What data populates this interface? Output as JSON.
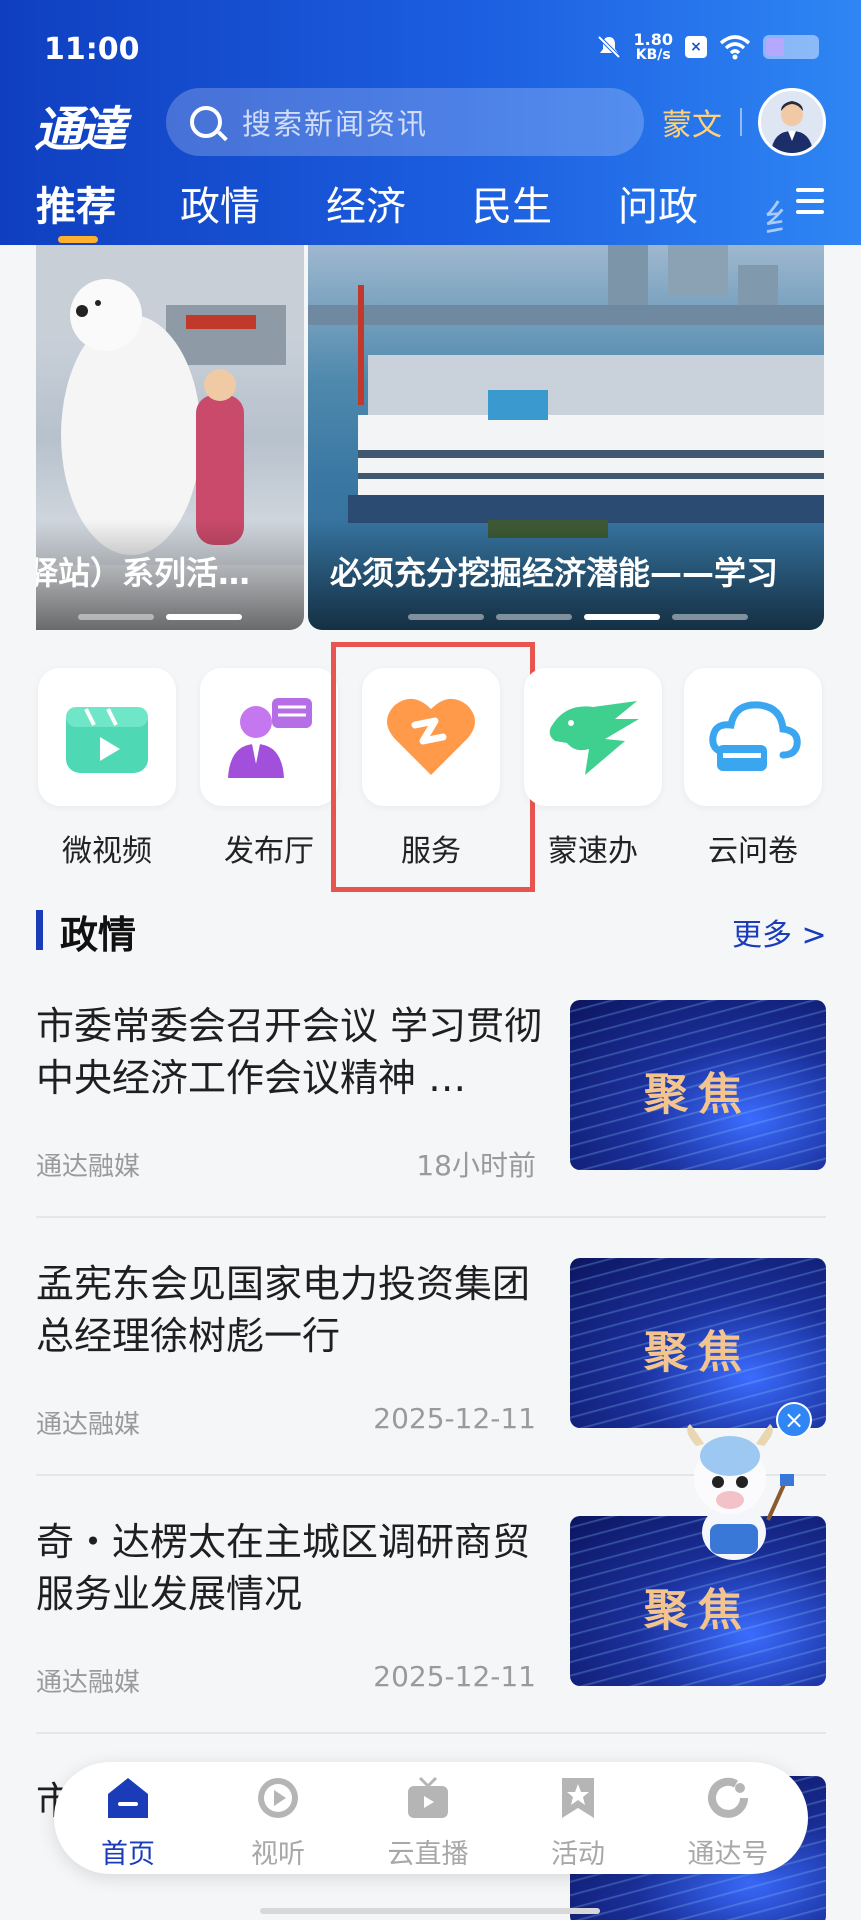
{
  "status_bar": {
    "time": "11:00",
    "net_speed_value": "1.80",
    "net_speed_unit": "KB/s",
    "icons": [
      "mute-icon",
      "sim-icon",
      "wifi-icon",
      "battery-icon"
    ]
  },
  "header": {
    "logo_text": "通達",
    "search_placeholder": "搜索新闻资讯",
    "language_button": "蒙文",
    "tabs": [
      {
        "label": "推荐",
        "active": true
      },
      {
        "label": "政情"
      },
      {
        "label": "经济"
      },
      {
        "label": "民生"
      },
      {
        "label": "问政"
      }
    ],
    "tab_partial": "纟"
  },
  "carousel": {
    "slides": [
      {
        "caption": "驿站）系列活…"
      },
      {
        "caption": "必须充分挖掘经济潜能——学习"
      }
    ]
  },
  "services": [
    {
      "label": "微视频",
      "icon": "video-clapper-icon"
    },
    {
      "label": "发布厅",
      "icon": "spokesperson-icon"
    },
    {
      "label": "服务",
      "icon": "heart-service-icon",
      "highlighted": true
    },
    {
      "label": "蒙速办",
      "icon": "horse-icon"
    },
    {
      "label": "云问卷",
      "icon": "cloud-book-icon"
    }
  ],
  "section": {
    "title": "政情",
    "more": "更多 >"
  },
  "news": [
    {
      "title": "市委常委会召开会议  学习贯彻中央经济工作会议精神  …",
      "source": "通达融媒",
      "time": "18小时前",
      "thumb_text": "聚焦"
    },
    {
      "title": "孟宪东会见国家电力投资集团总经理徐树彪一行",
      "source": "通达融媒",
      "time": "2025-12-11",
      "thumb_text": "聚焦"
    },
    {
      "title": "奇・达楞太在主城区调研商贸服务业发展情况",
      "source": "通达融媒",
      "time": "2025-12-11",
      "thumb_text": "聚焦"
    }
  ],
  "news_peek": "市",
  "mascot": {
    "close": "×"
  },
  "bottom_nav": [
    {
      "label": "首页",
      "icon": "home-icon",
      "active": true
    },
    {
      "label": "视听",
      "icon": "play-icon"
    },
    {
      "label": "云直播",
      "icon": "tv-icon"
    },
    {
      "label": "活动",
      "icon": "star-bookmark-icon"
    },
    {
      "label": "通达号",
      "icon": "refresh-icon"
    }
  ],
  "colors": {
    "header_start": "#0f3fc0",
    "header_end": "#2f86f4",
    "accent": "#1a3cb8",
    "tab_underline": "#ffb02e",
    "highlight_box": "#e85450"
  }
}
